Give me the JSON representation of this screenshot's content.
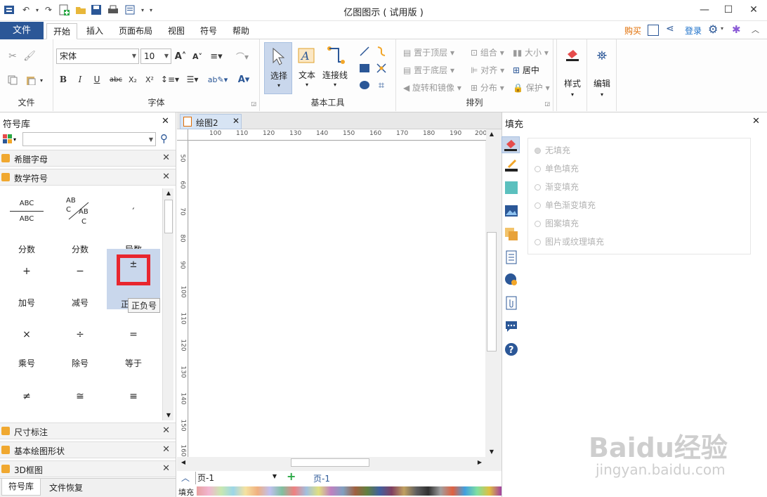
{
  "app": {
    "title": "亿图图示 ( 试用版 )"
  },
  "menu": {
    "file": "文件",
    "tabs": [
      "开始",
      "插入",
      "页面布局",
      "视图",
      "符号",
      "帮助"
    ],
    "buy": "购买",
    "login": "登录"
  },
  "ribbon": {
    "file_group": "文件",
    "font_group": "字体",
    "font_name": "宋体",
    "font_size": "10",
    "basic_tools_group": "基本工具",
    "select": "选择",
    "text": "文本",
    "connector": "连接线",
    "arrange_group": "排列",
    "bring_front": "置于顶层",
    "send_back": "置于底层",
    "rotate_mirror": "旋转和镜像",
    "group": "组合",
    "align": "对齐",
    "distribute": "分布",
    "size": "大小",
    "center": "居中",
    "protect": "保护",
    "style": "样式",
    "edit": "编辑"
  },
  "library": {
    "title": "符号库",
    "categories_top": [
      "希腊字母",
      "数学符号"
    ],
    "shapes": [
      {
        "label": "分数",
        "glyph": ""
      },
      {
        "label": "分数",
        "glyph": ""
      },
      {
        "label": "导数",
        "glyph": "′"
      },
      {
        "label": "加号",
        "glyph": "+"
      },
      {
        "label": "减号",
        "glyph": "−"
      },
      {
        "label": "正负号",
        "glyph": "±"
      },
      {
        "label": "乘号",
        "glyph": "×"
      },
      {
        "label": "除号",
        "glyph": "÷"
      },
      {
        "label": "等于",
        "glyph": "="
      },
      {
        "label": "",
        "glyph": "≠"
      },
      {
        "label": "",
        "glyph": "≅"
      },
      {
        "label": "",
        "glyph": "≡"
      }
    ],
    "fraction_glyph": {
      "top": "ABC",
      "bottom": "ABC"
    },
    "slash_fraction": {
      "a": "AB",
      "b": "C",
      "c": "AB",
      "d": "C"
    },
    "tooltip": "正负号",
    "categories_bottom": [
      "尺寸标注",
      "基本绘图形状",
      "3D框图"
    ],
    "bottom_tabs": [
      "符号库",
      "文件恢复"
    ]
  },
  "canvas": {
    "tab": "绘图2",
    "ruler_h": [
      "100",
      "110",
      "120",
      "130",
      "140",
      "150",
      "160",
      "170",
      "180",
      "190",
      "200"
    ],
    "ruler_v": [
      "50",
      "60",
      "70",
      "80",
      "90",
      "100",
      "110",
      "120",
      "130",
      "140",
      "150",
      "160"
    ],
    "page_select": "页-1",
    "page_tab": "页-1",
    "fill_label": "填充"
  },
  "fill_panel": {
    "title": "填充",
    "options": [
      "无填充",
      "单色填充",
      "渐变填充",
      "单色渐变填充",
      "图案填充",
      "图片或纹理填充"
    ],
    "selected_index": 0
  },
  "colors": {
    "accent": "#2b5797",
    "buy": "#e06c00",
    "login": "#1a6fc9",
    "highlight": "#e8262e",
    "selected_bg": "#c9d7ec"
  },
  "watermark": {
    "brand": "Baidu经验",
    "domain": "jingyan.baidu.com"
  }
}
